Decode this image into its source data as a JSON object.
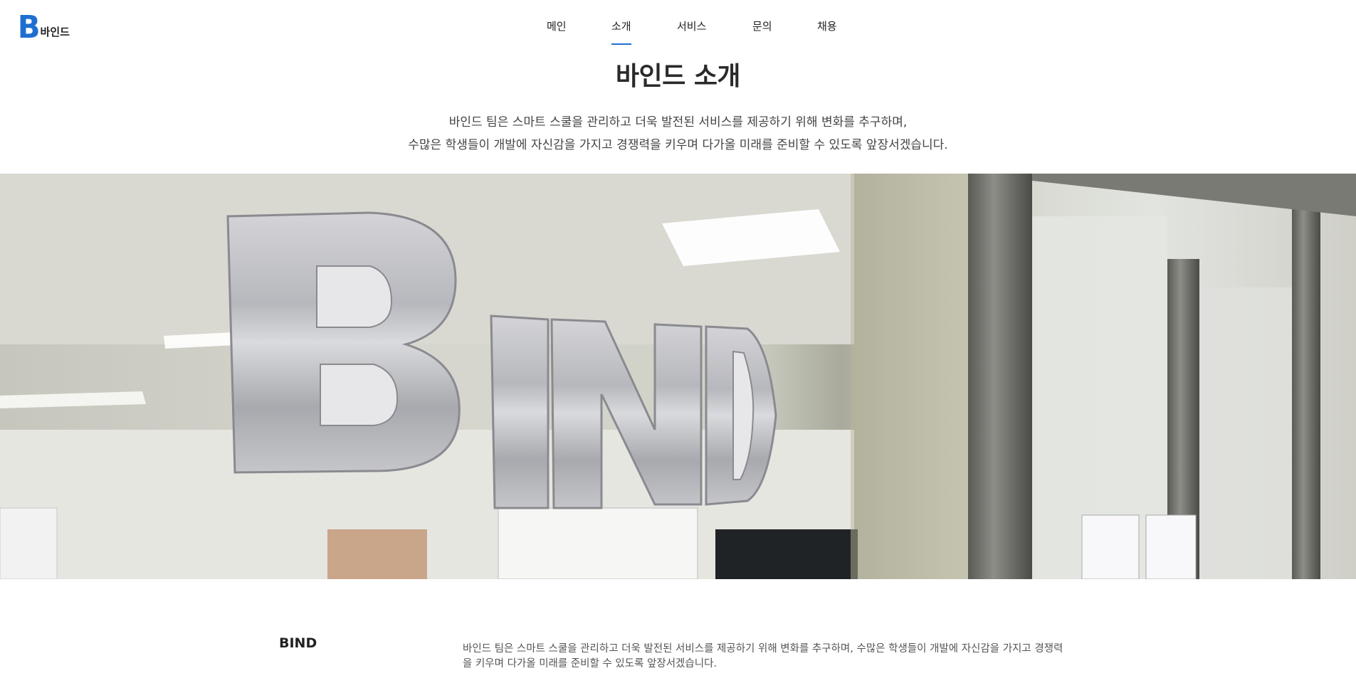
{
  "logo": {
    "mark": "B",
    "text": "바인드",
    "color": "#1f6fd1"
  },
  "nav": {
    "items": [
      {
        "label": "메인",
        "active": false
      },
      {
        "label": "소개",
        "active": true
      },
      {
        "label": "서비스",
        "active": false
      },
      {
        "label": "문의",
        "active": false
      },
      {
        "label": "채용",
        "active": false
      }
    ]
  },
  "intro": {
    "title": "바인드 소개",
    "line1": "바인드 팀은 스마트 스쿨을 관리하고 더욱 발전된 서비스를 제공하기 위해 변화를 추구하며,",
    "line2": "수많은 학생들이 개발에 자신감을 가지고 경쟁력을 키우며 다가올 미래를 준비할 수 있도록 앞장서겠습니다."
  },
  "hero": {
    "sign_text": "BIND"
  },
  "about": {
    "label": "BIND",
    "text": "바인드 팀은 스마트 스쿨을 관리하고 더욱 발전된 서비스를 제공하기 위해 변화를 추구하며, 수많은 학생들이 개발에 자신감을 가지고 경쟁력을 키우며 다가올 미래를 준비할 수 있도록 앞장서겠습니다."
  },
  "colors": {
    "accent": "#1f6fd1",
    "text": "#222222"
  }
}
